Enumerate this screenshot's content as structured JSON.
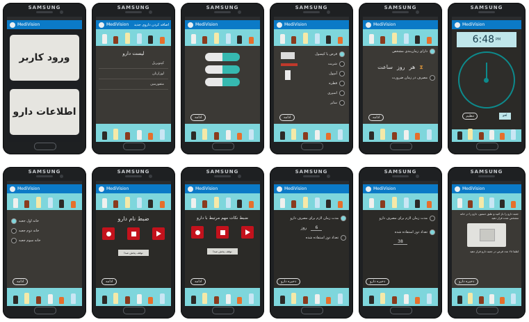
{
  "device": {
    "brand": "SAMSUNG"
  },
  "app": {
    "title": "MediVision"
  },
  "screen1": {
    "login_label": "ورود کاربر",
    "drug_info_label": "اطلاعات دارو"
  },
  "screen2": {
    "toolbar_text": "اضافه کردن داروی جدید",
    "section_title": "لیست دارو",
    "items": [
      "کپتوپریل",
      "لوزارتان",
      "متفورمین"
    ]
  },
  "screen4": {
    "options": [
      "قرص یا کپسول",
      "شربت",
      "آمپول",
      "قطره",
      "اسپری",
      "سایر"
    ]
  },
  "screen5": {
    "option1": "دارای زمان‌بندی مشخص",
    "option2": "مصرف در زمان ضرورت",
    "period": {
      "day": "روز",
      "hour": "ساعت",
      "every": "هر"
    }
  },
  "screen6": {
    "time": "6:48",
    "suffix": "PM",
    "cancel": "لغو",
    "ok": "تنظیم"
  },
  "screen7": {
    "options": [
      "خانه اول جعبه",
      "خانه دوم جعبه",
      "خانه سوم جعبه"
    ]
  },
  "screen8": {
    "heading": "ضبط نام دارو",
    "stop_label": "توقف پخش صدا"
  },
  "screen9": {
    "heading": "ضبط نکات مهم مرتبط با دارو",
    "stop_label": "توقف پخش صدا"
  },
  "screen10": {
    "duration_label": "مدت زمان لازم برای مصرف دارو",
    "duration_value": "6",
    "duration_unit": "روز",
    "count_label": "تعداد دوز استفاده شده"
  },
  "screen11": {
    "duration_label": "مدت زمان لازم برای مصرف دارو",
    "count_label": "تعداد دوز استفاده شده",
    "count_value": "38"
  },
  "screen12": {
    "body_text": "جعبه دارو را باز کنید و طبق دستور، دارو را در خانه مشخص شده قرار دهید",
    "caption": "لطفا ۲۸ عدد قرص در جعبه دارو قرار دهید"
  },
  "buttons": {
    "next": "ادامه",
    "save": "ذخیره دارو"
  },
  "colors": {
    "accent": "#0b7ac7",
    "shelf": "#7ed6dc",
    "record": "#c3121c",
    "screen_bg": "#3b3935"
  }
}
